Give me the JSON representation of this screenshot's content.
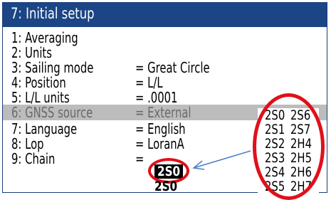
{
  "title": "7: Initial setup",
  "menu": [
    {
      "label": "1: Averaging",
      "value": ""
    },
    {
      "label": "2: Units",
      "value": ""
    },
    {
      "label": "3: Sailing mode",
      "value": "= Great Circle"
    },
    {
      "label": "4: Position",
      "value": "= L/L"
    },
    {
      "label": "5: L/L units",
      "value": "= .0001"
    },
    {
      "label": "6: GNSS source",
      "value": "= External",
      "highlighted": true
    },
    {
      "label": "7: Language",
      "value": "= English"
    },
    {
      "label": "8: Lop",
      "value": "= LoranA"
    },
    {
      "label": "9: Chain",
      "value": "="
    }
  ],
  "chain": {
    "selected": "2S0",
    "next_option": "2S0"
  },
  "chain_options": [
    [
      "2S0",
      "2S6"
    ],
    [
      "2S1",
      "2S7"
    ],
    [
      "2S2",
      "2H4"
    ],
    [
      "2S3",
      "2H5"
    ],
    [
      "2S4",
      "2H6"
    ],
    [
      "2S5",
      "2H7"
    ]
  ],
  "colors": {
    "titlebar": "#1b4585",
    "highlight_row": "#bcbcbc",
    "annotation_red": "#e0101a",
    "annotation_arrow": "#4a7ec8"
  }
}
